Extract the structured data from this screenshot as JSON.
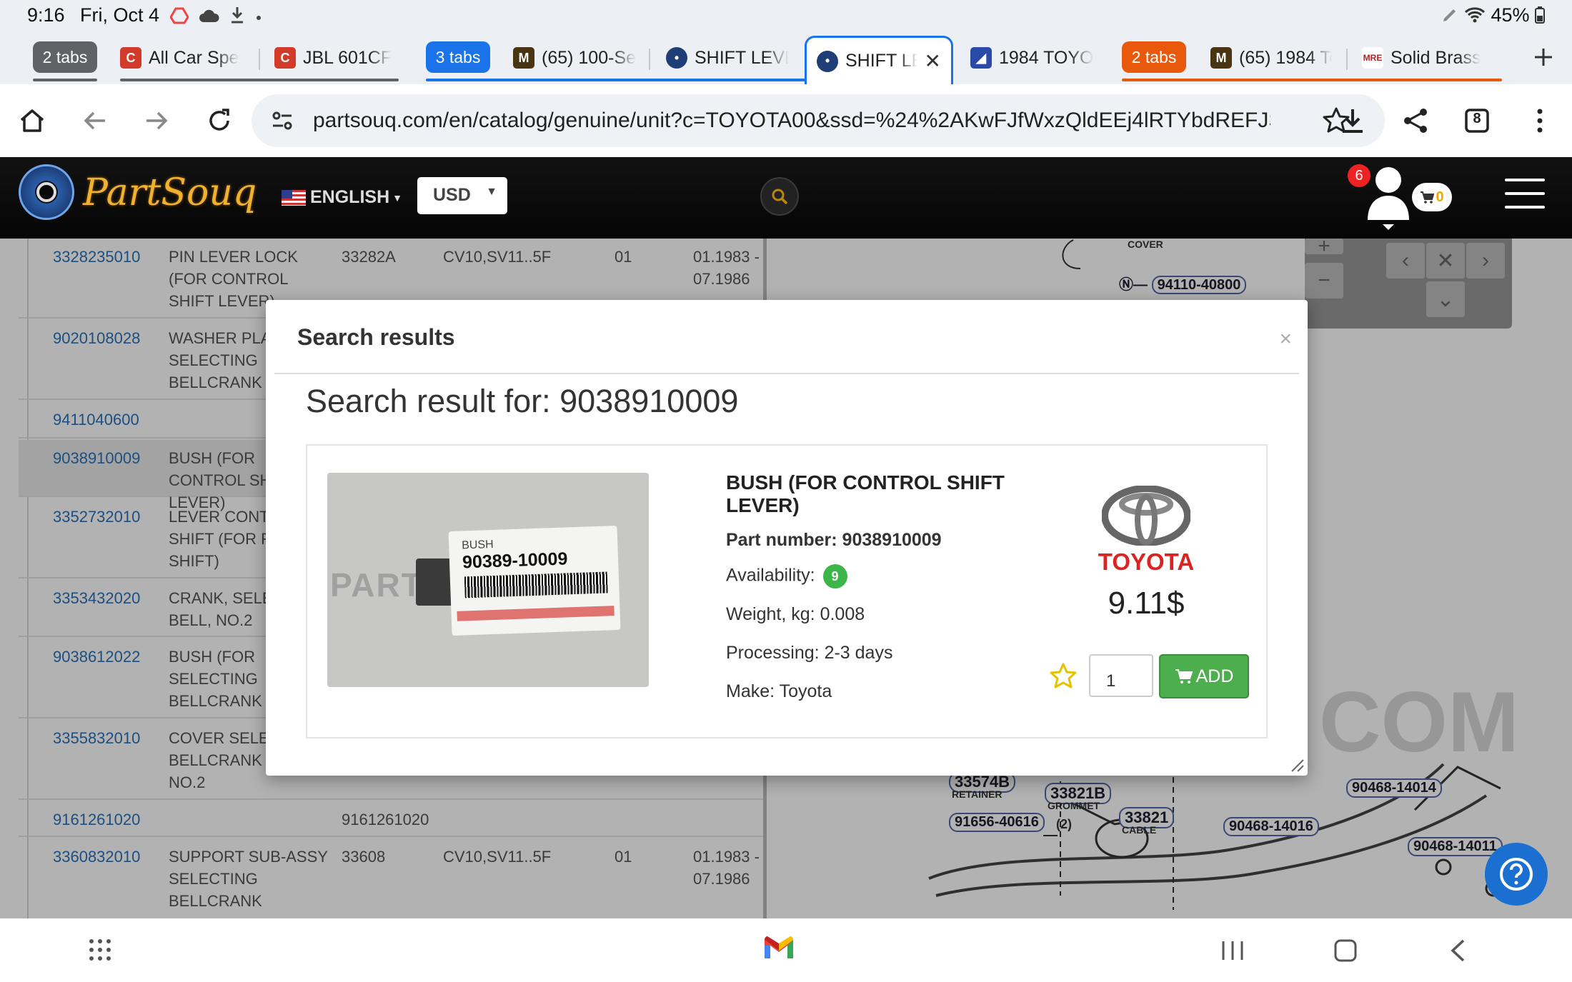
{
  "status_bar": {
    "time": "9:16",
    "date": "Fri, Oct 4",
    "battery": "45%"
  },
  "tabs": {
    "group1_label": "2 tabs",
    "tab_allcar": "All Car Spe",
    "tab_jbl": "JBL 601CF",
    "group2_label": "3 tabs",
    "tab_100": "(65) 100-Se",
    "tab_shift1": "SHIFT LEVE",
    "tab_active": "SHIFT LE",
    "tab_1984": "1984 TOYO",
    "group3_label": "2 tabs",
    "tab_65_1984": "(65) 1984 To",
    "tab_brass": "Solid Brass"
  },
  "browser": {
    "url": "partsouq.com/en/catalog/genuine/unit?c=TOYOTA00&ssd=%24%2AKwFJfWxzQldEEj4lRTYbdREFJS",
    "tab_count": "8"
  },
  "site_header": {
    "logo": "PartSouq",
    "language": "ENGLISH",
    "currency": "USD",
    "notification_count": "6",
    "cart_count": "0"
  },
  "parts_table": [
    {
      "number": "3328235010",
      "name": "PIN LEVER LOCK (FOR CONTROL SHIFT LEVER)",
      "code": "33282A",
      "model": "CV10,SV11..5F",
      "qty": "01",
      "date": "01.1983 - 07.1986"
    },
    {
      "number": "9020108028",
      "name": "WASHER PLATE, SELECTING BELLCRANK NO.1",
      "code": "",
      "model": "",
      "qty": "",
      "date": ""
    },
    {
      "number": "9411040600",
      "name": "",
      "code": "",
      "model": "",
      "qty": "",
      "date": ""
    },
    {
      "number": "9038910009",
      "name": "BUSH (FOR CONTROL SHIFT LEVER)",
      "code": "",
      "model": "",
      "qty": "",
      "date": ""
    },
    {
      "number": "3352732010",
      "name": "LEVER CONTROL SHIFT (FOR FLOOR SHIFT)",
      "code": "",
      "model": "",
      "qty": "",
      "date": ""
    },
    {
      "number": "3353432020",
      "name": "CRANK, SELECTING BELL, NO.2",
      "code": "",
      "model": "",
      "qty": "",
      "date": ""
    },
    {
      "number": "9038612022",
      "name": "BUSH (FOR SELECTING BELLCRANK NO.1)",
      "code": "",
      "model": "",
      "qty": "",
      "date": ""
    },
    {
      "number": "3355832010",
      "name": "COVER SELECTING BELLCRANK DUST, NO.2",
      "code": "",
      "model": "",
      "qty": "",
      "date": ""
    },
    {
      "number": "9161261020",
      "name": "",
      "code": "9161261020",
      "model": "",
      "qty": "",
      "date": ""
    },
    {
      "number": "3360832010",
      "name": "SUPPORT SUB-ASSY SELECTING BELLCRANK",
      "code": "33608",
      "model": "CV10,SV11..5F",
      "qty": "01",
      "date": "01.1983 - 07.1986"
    }
  ],
  "diagram_labels": {
    "l1": "COVER",
    "l2": "94110-40800",
    "l3": "33574B",
    "l3sub": "RETAINER",
    "l4": "33821B",
    "l4sub": "GROMMET",
    "l5": "33821",
    "l5sub": "CABLE",
    "l6": "91656-40616",
    "l6b": "(2)",
    "l7": "90468-14014",
    "l8": "90468-14016",
    "l9": "90468-14011",
    "watermark": "COM"
  },
  "modal": {
    "title": "Search results",
    "close": "×",
    "heading": "Search result for: 9038910009",
    "product": {
      "name": "BUSH (FOR CONTROL SHIFT LEVER)",
      "part_label": "Part number:",
      "part_number": "9038910009",
      "availability_label": "Availability:",
      "availability": "9",
      "weight_label": "Weight, kg:",
      "weight": "0.008",
      "processing_label": "Processing:",
      "processing": "2-3 days",
      "make_label": "Make:",
      "make": "Toyota",
      "brand": "TOYOTA",
      "price": "9.11$",
      "qty": "1",
      "add_label": "ADD",
      "photo_label_top": "BUSH",
      "photo_label_code": "90389-10009",
      "photo_watermark": "PARTSOUQ.COM"
    }
  }
}
